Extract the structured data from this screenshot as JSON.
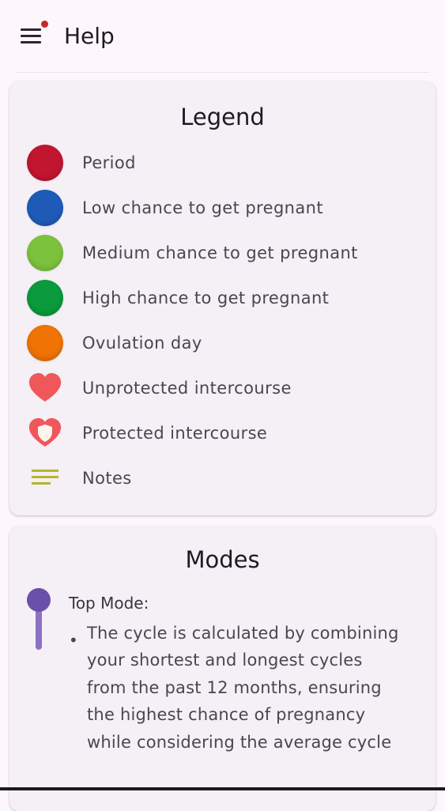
{
  "app_bar": {
    "title": "Help",
    "menu_icon": "menu-icon",
    "notification_color": "#c62828"
  },
  "legend": {
    "title": "Legend",
    "items": [
      {
        "label": "Period",
        "icon": "period-dot-icon",
        "color": "#c2152f"
      },
      {
        "label": "Low chance to get pregnant",
        "icon": "low-chance-dot-icon",
        "color": "#1e5bb8"
      },
      {
        "label": "Medium chance to get pregnant",
        "icon": "medium-chance-dot-icon",
        "color": "#7cc23d"
      },
      {
        "label": "High chance to get pregnant",
        "icon": "high-chance-dot-icon",
        "color": "#0b9a3c"
      },
      {
        "label": "Ovulation day",
        "icon": "ovulation-dot-icon",
        "color": "#ef7305"
      },
      {
        "label": "Unprotected intercourse",
        "icon": "heart-icon",
        "color": "#f0575a"
      },
      {
        "label": "Protected intercourse",
        "icon": "heart-shield-icon",
        "color": "#f0575a"
      },
      {
        "label": "Notes",
        "icon": "notes-icon",
        "color": "#b5b62a"
      }
    ]
  },
  "modes": {
    "title": "Modes",
    "top_mode": {
      "heading": "Top Mode:",
      "bullet": "•",
      "description": "The cycle is calculated by combining your shortest and longest cycles from the past 12 months, ensuring the highest chance of pregnancy while considering the average cycle"
    },
    "slider_color": "#6a50a8"
  }
}
